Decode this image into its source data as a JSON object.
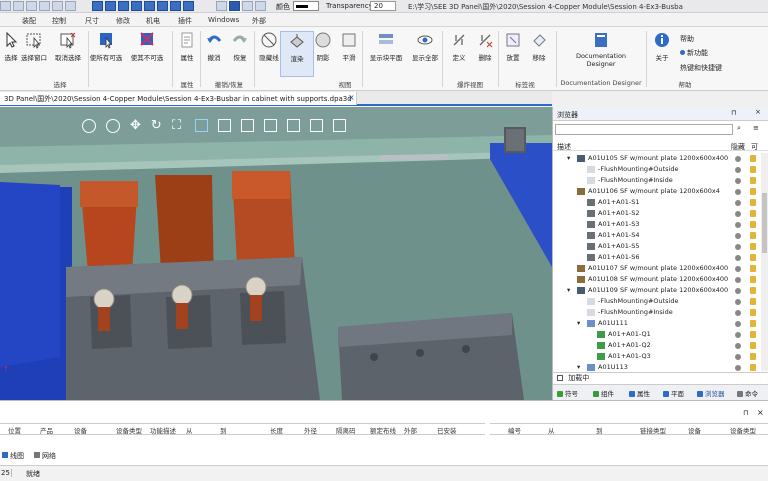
{
  "toolbar": {
    "color_label": "颜色",
    "transparency_label": "Transparency",
    "transparency_value": "20",
    "window_title": "E:\\学习\\SEE 3D Panel\\国外\\2020\\Session 4-Copper Module\\Session 4-Ex3-Busba"
  },
  "menu": {
    "tabs": [
      "装配",
      "控制",
      "尺寸",
      "修改",
      "机电",
      "插件",
      "Windows",
      "外部"
    ]
  },
  "ribbon": {
    "buttons": [
      {
        "label": "选择",
        "icon": "cursor-icon"
      },
      {
        "label": "选择窗口",
        "icon": "select-window-icon"
      },
      {
        "label": "取消选择",
        "icon": "deselect-icon"
      },
      {
        "label": "使所有可选",
        "icon": "make-selectable-icon"
      },
      {
        "label": "使其不可选",
        "icon": "make-unselectable-icon"
      },
      {
        "label": "属性",
        "icon": "properties-icon"
      },
      {
        "label": "撤消",
        "icon": "undo-icon"
      },
      {
        "label": "恢复",
        "icon": "redo-icon"
      },
      {
        "label": "隐藏线",
        "icon": "hidden-lines-icon"
      },
      {
        "label": "渲染",
        "icon": "render-icon"
      },
      {
        "label": "阴影",
        "icon": "shadow-icon"
      },
      {
        "label": "平滑",
        "icon": "smooth-icon"
      },
      {
        "label": "显示块平面",
        "icon": "block-plane-icon"
      },
      {
        "label": "显示全部",
        "icon": "show-all-icon"
      },
      {
        "label": "定义",
        "icon": "define-icon"
      },
      {
        "label": "删除",
        "icon": "delete-icon"
      },
      {
        "label": "放置",
        "icon": "place-icon"
      },
      {
        "label": "移除",
        "icon": "remove-icon"
      },
      {
        "label": "Documentation Designer",
        "icon": "documentation-designer-icon"
      },
      {
        "label": "关于",
        "icon": "about-icon"
      }
    ],
    "help_items": [
      "帮助",
      "新功能",
      "热键和快捷键"
    ],
    "groups": [
      "选择",
      "属性",
      "撤销/恢复",
      "视图",
      "爆炸视图",
      "标签视",
      "Documentation Designer",
      "帮助"
    ]
  },
  "document": {
    "tab_title": "3D Panel\\国外\\2020\\Session 4-Copper Module\\Session 4-Ex3-Busbar in cabinet with supports.dpa3d"
  },
  "explorer": {
    "title": "浏览器",
    "columns": [
      "描述",
      "隐藏",
      "可"
    ],
    "items": [
      {
        "name": "A01U105 SF w/mount plate 1200x600x400",
        "indent": 1,
        "icon": "cabinet-icon"
      },
      {
        "name": "-FlushMounting#Outside",
        "indent": 2,
        "icon": "flush-icon"
      },
      {
        "name": "-FlushMounting#Inside",
        "indent": 2,
        "icon": "flush-icon"
      },
      {
        "name": "A01U106 SF w/mount plate 1200x600x4",
        "indent": 1,
        "icon": "cross-icon"
      },
      {
        "name": "A01+A01-S1",
        "indent": 2,
        "icon": "device-icon"
      },
      {
        "name": "A01+A01-S2",
        "indent": 2,
        "icon": "device-icon"
      },
      {
        "name": "A01+A01-S3",
        "indent": 2,
        "icon": "device-icon"
      },
      {
        "name": "A01+A01-S4",
        "indent": 2,
        "icon": "device-icon"
      },
      {
        "name": "A01+A01-S5",
        "indent": 2,
        "icon": "device-icon"
      },
      {
        "name": "A01+A01-S6",
        "indent": 2,
        "icon": "device-icon"
      },
      {
        "name": "A01U107 SF w/mount plate 1200x600x400",
        "indent": 1,
        "icon": "cross-icon"
      },
      {
        "name": "A01U108 SF w/mount plate 1200x600x400",
        "indent": 1,
        "icon": "cross-icon"
      },
      {
        "name": "A01U109 SF w/mount plate 1200x600x400",
        "indent": 1,
        "icon": "cabinet-icon"
      },
      {
        "name": "-FlushMounting#Outside",
        "indent": 2,
        "icon": "flush-icon"
      },
      {
        "name": "-FlushMounting#Inside",
        "indent": 2,
        "icon": "flush-icon"
      },
      {
        "name": "A01U111",
        "indent": 2,
        "icon": "rail-icon"
      },
      {
        "name": "A01+A01-Q1",
        "indent": 3,
        "icon": "breaker-icon"
      },
      {
        "name": "A01+A01-Q2",
        "indent": 3,
        "icon": "breaker-icon"
      },
      {
        "name": "A01+A01-Q3",
        "indent": 3,
        "icon": "breaker-icon"
      },
      {
        "name": "A01U113",
        "indent": 2,
        "icon": "rail-icon"
      }
    ],
    "footer_label": "加载中",
    "tabs": [
      "符号",
      "组件",
      "属性",
      "平面",
      "浏览器",
      "命令"
    ]
  },
  "bottom_panel": {
    "columns_left": [
      "位置",
      "产品",
      "设备",
      "设备类型",
      "功能描述",
      "从",
      "到",
      "长度",
      "外径",
      "隔离码",
      "额定布线",
      "外部",
      "已安装"
    ],
    "columns_right": [
      "编号",
      "从",
      "到",
      "链接类型",
      "设备",
      "设备类型"
    ],
    "tabs": [
      "线图",
      "网络"
    ],
    "status_zoom": "25",
    "status_text": "就绪"
  }
}
